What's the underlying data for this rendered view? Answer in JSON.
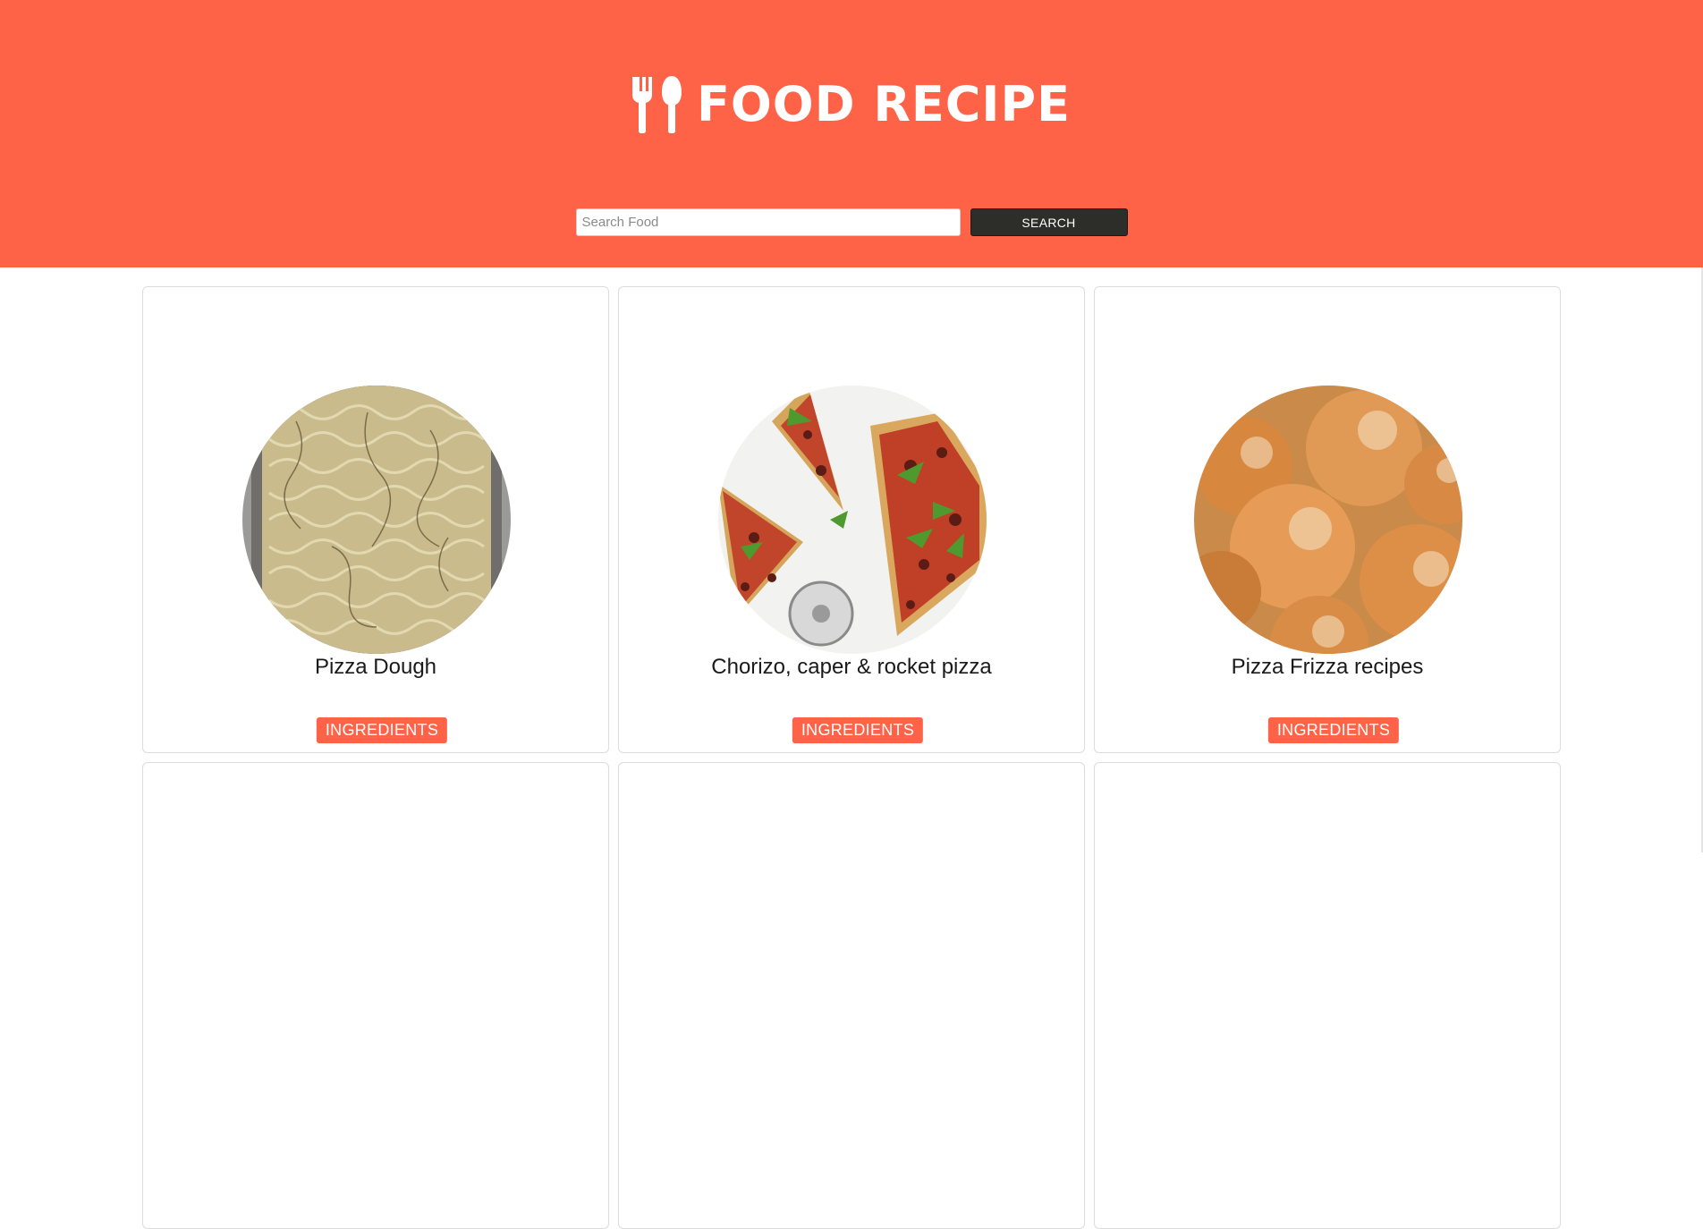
{
  "header": {
    "title": "FOOD RECIPE",
    "logo_icon": "fork-spoon-icon",
    "background_color": "#ff6347"
  },
  "search": {
    "placeholder": "Search Food",
    "value": "",
    "button_label": "SEARCH",
    "button_color": "#2d2e2a"
  },
  "recipes": [
    {
      "title": "Pizza Dough",
      "image": "focaccia-dough-photo",
      "button_label": "INGREDIENTS"
    },
    {
      "title": "Chorizo, caper & rocket pizza",
      "image": "chorizo-rocket-pizza-photo",
      "button_label": "INGREDIENTS"
    },
    {
      "title": "Pizza Frizza recipes",
      "image": "sugared-dough-balls-photo",
      "button_label": "INGREDIENTS"
    },
    {
      "title": "",
      "image": "",
      "button_label": ""
    },
    {
      "title": "",
      "image": "",
      "button_label": ""
    },
    {
      "title": "",
      "image": "",
      "button_label": ""
    }
  ],
  "accent_color": "#ff6347"
}
